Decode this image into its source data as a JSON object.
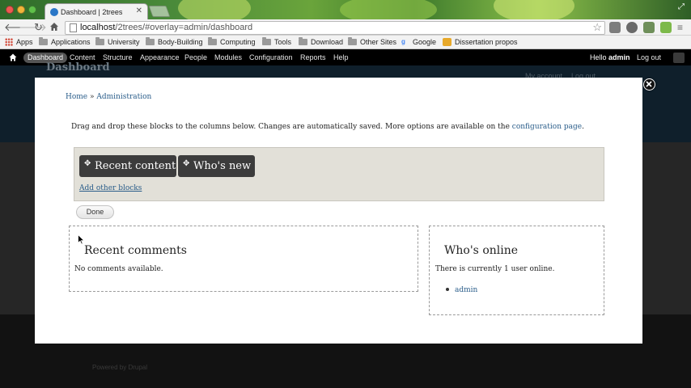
{
  "browser": {
    "tab_title": "Dashboard | 2trees",
    "url_host": "localhost",
    "url_path": "/2trees/#overlay=admin/dashboard",
    "bookmarks": [
      {
        "label": "Apps",
        "icon": "apps-grid-icon"
      },
      {
        "label": "Applications",
        "icon": "folder-icon"
      },
      {
        "label": "University",
        "icon": "folder-icon"
      },
      {
        "label": "Body-Building",
        "icon": "folder-icon"
      },
      {
        "label": "Computing",
        "icon": "folder-icon"
      },
      {
        "label": "Tools",
        "icon": "folder-icon"
      },
      {
        "label": "Download",
        "icon": "folder-icon"
      },
      {
        "label": "Other Sites",
        "icon": "folder-icon"
      },
      {
        "label": "Google",
        "icon": "google-icon"
      },
      {
        "label": "Dissertation propos",
        "icon": "gmail-icon"
      }
    ],
    "extensions": [
      {
        "name": "abp-icon",
        "color": "#7d7d7d"
      },
      {
        "name": "gear-icon",
        "color": "#6a6a6a"
      },
      {
        "name": "puzzle-icon",
        "color": "#6f8f5a"
      },
      {
        "name": "evernote-icon",
        "color": "#7db94a"
      },
      {
        "name": "menu-icon",
        "color": "#666666"
      }
    ]
  },
  "drupal_toolbar": {
    "menu": [
      "Dashboard",
      "Content",
      "Structure",
      "Appearance",
      "People",
      "Modules",
      "Configuration",
      "Reports",
      "Help"
    ],
    "hello_prefix": "Hello ",
    "username": "admin",
    "logout": "Log out"
  },
  "background_page": {
    "title": "Dashboard",
    "my_account": "My account",
    "log_out": "Log out",
    "powered_by": "Powered by Drupal"
  },
  "overlay": {
    "breadcrumb": [
      "Home",
      "Administration"
    ],
    "breadcrumb_sep": " » ",
    "intro_text": "Drag and drop these blocks to the columns below. Changes are automatically saved. More options are available on the ",
    "intro_link": "configuration page",
    "intro_end": ".",
    "disabled_blocks": [
      "Recent content",
      "Who's new"
    ],
    "add_other_blocks": "Add other blocks",
    "done_label": "Done",
    "main_region": {
      "block_title": "Recent comments",
      "block_text": "No comments available."
    },
    "sidebar_region": {
      "block_title": "Who's online",
      "block_text": "There is currently 1 user online.",
      "users": [
        "admin"
      ]
    }
  },
  "colors": {
    "drupal_toolbar": "#000000",
    "link": "#2a5d8a",
    "block_tab": "#3c3c3c",
    "disabled_region_bg": "#e2e0d8"
  }
}
